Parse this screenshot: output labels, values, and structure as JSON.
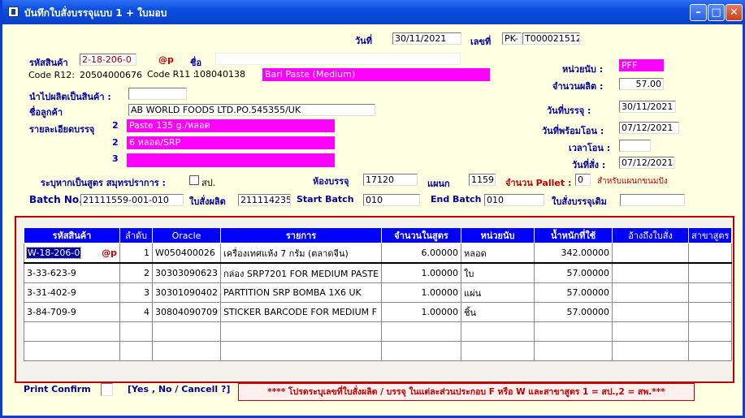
{
  "window": {
    "title": "บันทึกใบสั่งบรรจุแบบ 1 + ใบมอบ"
  },
  "header": {
    "date_label": "วันที่",
    "date_value": "30/11/2021",
    "doc_no_label": "เลขที่",
    "doc_prefix": "PK-",
    "doc_no": "T000021512"
  },
  "product": {
    "code_label": "รหัสสินค้า",
    "code_value": "2-18-206-0",
    "at_p": "@p",
    "name_label": "ชื่อ",
    "name_value": "",
    "r12_label": "Code R12:",
    "r12_value": "20504000676",
    "r11_label": "Code R11 :",
    "r11_value": "108040138",
    "desc_value": "Bari Paste (Medium)"
  },
  "right_fields": {
    "unit_label": "หน่วยนับ :",
    "unit_value": "PFF",
    "qty_label": "จำนวนผลิต :",
    "qty_value": "57.00",
    "pack_date_label": "วันที่บรรจุ :",
    "pack_date_value": "30/11/2021",
    "ready_date_label": "วันที่พร้อมโอน :",
    "ready_date_value": "07/12/2021",
    "transfer_time_label": "เวลาโอน :",
    "transfer_time_value": "",
    "order_date_label": "วันที่สั่ง :",
    "order_date_value": "07/12/2021"
  },
  "details": {
    "produce_product_label": "นำไปผลิตเป็นสินค้า :",
    "produce_product_value": "",
    "customer_label": "ชื่อลูกค้า",
    "customer_value": "AB WORLD  FOODS LTD.PO.545355/UK",
    "pack_detail_label": "รายละเอียดบรรจุ",
    "pack_lines": [
      {
        "no": "2",
        "text": "Paste 135 g./หลอด"
      },
      {
        "no": "2",
        "text": "6 หลอด/SRP"
      },
      {
        "no": "3",
        "text": ""
      }
    ]
  },
  "row_formula": {
    "formula_label": "ระบุหากเป็นสูตร สมุทรปราการ :",
    "formula_chk_label": "สป.",
    "room_label": "ห้องบรรจุ",
    "room_value": "17120",
    "dept_label": "แผนก",
    "dept_value": "1159",
    "pallet_label": "จำนวน Pallet :",
    "pallet_value": "0",
    "pallet_note": "สำหรับแผนกขนมปัง"
  },
  "row_batch": {
    "batch_label": "Batch No.",
    "batch_value": "21111559-001-010",
    "order_label": "ใบสั่งผลิต",
    "order_value": "211114235",
    "start_label": "Start Batch",
    "start_value": "010",
    "end_label": "End Batch",
    "end_value": "010",
    "orig_order_label": "ใบสั่งบรรจุเดิม",
    "orig_order_value": ""
  },
  "table": {
    "headers": [
      "รหัสสินค้า",
      "ลำดับ",
      "Oracle",
      "รายการ",
      "จำนวนในสูตร",
      "หน่วยนับ",
      "น้ำหนักที่ใช้",
      "อ้างถึงใบสั่ง",
      "สาขาสูตร"
    ],
    "rows": [
      {
        "code": "W-18-206-0",
        "flag": "@p",
        "seq": "1",
        "oracle": "W050400026",
        "item": "เครื่องเทศแห้ง 7 กรัม (ตลาดจีน)",
        "qty": "6.00000",
        "unit": "หลอด",
        "weight": "342.00000",
        "ref": "",
        "branch": ""
      },
      {
        "code": "3-33-623-9",
        "flag": "",
        "seq": "2",
        "oracle": "30303090623",
        "item": "กล่อง SRP7201 FOR MEDIUM PASTE",
        "qty": "1.00000",
        "unit": "ใบ",
        "weight": "57.00000",
        "ref": "",
        "branch": ""
      },
      {
        "code": "3-31-402-9",
        "flag": "",
        "seq": "3",
        "oracle": "30301090402",
        "item": "PARTITION SRP BOMBA 1X6 UK",
        "qty": "1.00000",
        "unit": "แผ่น",
        "weight": "57.00000",
        "ref": "",
        "branch": ""
      },
      {
        "code": "3-84-709-9",
        "flag": "",
        "seq": "4",
        "oracle": "30804090709",
        "item": "STICKER BARCODE FOR MEDIUM F",
        "qty": "1.00000",
        "unit": "ชิ้น",
        "weight": "57.00000",
        "ref": "",
        "branch": ""
      }
    ]
  },
  "footer": {
    "print_label": "Print Confirm",
    "print_hint": "[Yes , No / Cancell ?]",
    "message": "**** โปรดระบุเลขที่ใบสั่งผลิต / บรรจุ ในแต่ละส่วนประกอบ F หรือ W และสาขาสูตร 1 = สป.,2 = สพ.***"
  }
}
